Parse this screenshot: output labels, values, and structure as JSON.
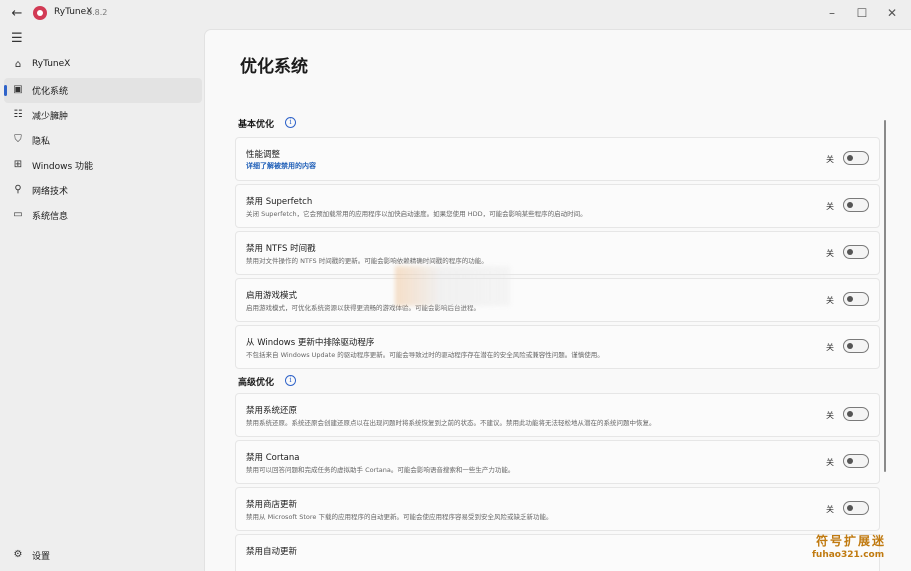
{
  "window": {
    "app_name": "RyTuneX",
    "version": "0.8.2",
    "back_icon": "back-arrow-icon",
    "controls": [
      "minimize-icon",
      "maximize-icon",
      "close-icon"
    ]
  },
  "sidebar": {
    "items": [
      {
        "label": "RyTuneX",
        "icon": "home-icon",
        "active": false
      },
      {
        "label": "优化系统",
        "icon": "optimize-icon",
        "active": true
      },
      {
        "label": "减少臃肿",
        "icon": "list-icon",
        "active": false
      },
      {
        "label": "隐私",
        "icon": "shield-icon",
        "active": false
      },
      {
        "label": "Windows 功能",
        "icon": "apps-icon",
        "active": false
      },
      {
        "label": "网络技术",
        "icon": "network-icon",
        "active": false
      },
      {
        "label": "系统信息",
        "icon": "monitor-icon",
        "active": false
      }
    ],
    "settings_label": "设置"
  },
  "main": {
    "title": "优化系统",
    "sections": [
      {
        "heading": "基本优化",
        "items": [
          {
            "title": "性能调整",
            "link": "详细了解被禁用的内容",
            "toggle": "关"
          },
          {
            "title": "禁用 Superfetch",
            "desc": "关闭 Superfetch，它会预加载常用的应用程序以加快启动速度。如果您使用 HDD，可能会影响某些程序的启动时间。",
            "toggle": "关"
          },
          {
            "title": "禁用 NTFS 时间戳",
            "desc": "禁用对文件操作的 NTFS 时间戳的更新。可能会影响依赖精确时间戳的程序的功能。",
            "toggle": "关"
          },
          {
            "title": "启用游戏模式",
            "desc": "启用游戏模式，可优化系统资源以获得更流畅的游戏体验。可能会影响后台进程。",
            "toggle": "关"
          },
          {
            "title": "从 Windows 更新中排除驱动程序",
            "desc": "不包括来自 Windows Update 的驱动程序更新。可能会导致过时的驱动程序存在潜在的安全风险或兼容性问题。谨慎使用。",
            "toggle": "关"
          }
        ]
      },
      {
        "heading": "高级优化",
        "items": [
          {
            "title": "禁用系统还原",
            "desc": "禁用系统还原。系统还原会创建还原点以在出现问题时将系统恢复到之前的状态。不建议。禁用此功能将无法轻松地从潜在的系统问题中恢复。",
            "toggle": "关"
          },
          {
            "title": "禁用 Cortana",
            "desc": "禁用可以回答问题和完成任务的虚拟助手 Cortana。可能会影响语音搜索和一些生产力功能。",
            "toggle": "关"
          },
          {
            "title": "禁用商店更新",
            "desc": "禁用从 Microsoft Store 下载的应用程序的自动更新。可能会使应用程序容易受到安全风险或缺乏新功能。",
            "toggle": "关"
          },
          {
            "title": "禁用自动更新",
            "desc": "",
            "toggle": ""
          }
        ]
      }
    ]
  },
  "watermark": {
    "title": "符号扩展迷",
    "url": "fuhao321.com"
  }
}
